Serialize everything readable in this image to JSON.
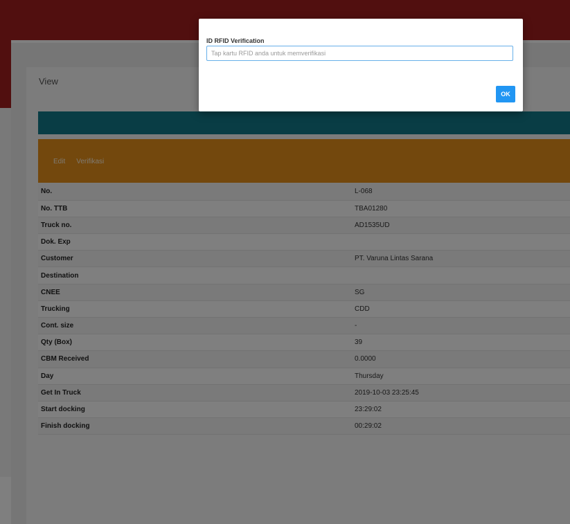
{
  "page": {
    "view_title": "View",
    "tabs": [
      "Edit",
      "Verifikasi"
    ]
  },
  "details": [
    {
      "label": "No.",
      "value": "L-068"
    },
    {
      "label": "No. TTB",
      "value": "TBA01280"
    },
    {
      "label": "Truck no.",
      "value": "AD1535UD"
    },
    {
      "label": "Dok. Exp",
      "value": ""
    },
    {
      "label": "Customer",
      "value": "PT. Varuna Lintas Sarana"
    },
    {
      "label": "Destination",
      "value": ""
    },
    {
      "label": "CNEE",
      "value": "SG"
    },
    {
      "label": "Trucking",
      "value": "CDD"
    },
    {
      "label": "Cont. size",
      "value": "-"
    },
    {
      "label": "Qty (Box)",
      "value": "39"
    },
    {
      "label": "CBM Received",
      "value": "0.0000"
    },
    {
      "label": "Day",
      "value": "Thursday"
    },
    {
      "label": "Get In Truck",
      "value": "2019-10-03 23:25:45"
    },
    {
      "label": "Start docking",
      "value": "23:29:02"
    },
    {
      "label": "Finish docking",
      "value": "00:29:02"
    }
  ],
  "modal": {
    "label": "ID RFID Verification",
    "input_placeholder": "Tap kartu RFID anda untuk memverifikasi",
    "input_value": "",
    "ok_label": "OK"
  },
  "colors": {
    "topbar": "#a31f1f",
    "teal_bar": "#127a8a",
    "orange_bar": "#e6901a",
    "ok_button": "#2196f3"
  }
}
